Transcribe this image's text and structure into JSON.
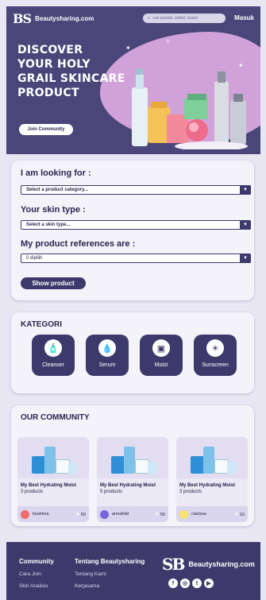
{
  "header": {
    "logo_mark": "BS",
    "brand": "Beautysharing.com",
    "search_placeholder": "cari produk, artikel, brand",
    "login": "Masuk"
  },
  "hero": {
    "line1": "DISCOVER",
    "line2": "YOUR HOLY",
    "line3": "GRAIL SKINCARE",
    "line4": "PRODUCT",
    "join_label": "Join Community"
  },
  "filter": {
    "looking_label": "I am looking for :",
    "category_value": "Select a product category...",
    "skin_label": "Your skin type :",
    "skin_value": "Select a skin type...",
    "ref_label": "My product references are :",
    "ref_value": "0 dipilih",
    "show_label": "Show product"
  },
  "kategori": {
    "title": "KATEGORI",
    "items": [
      {
        "label": "Cleanser",
        "icon": "cleanser-icon"
      },
      {
        "label": "Serum",
        "icon": "serum-icon"
      },
      {
        "label": "Moist",
        "icon": "moisturizer-icon"
      },
      {
        "label": "Sunscreen",
        "icon": "sunscreen-icon"
      }
    ]
  },
  "community": {
    "title": "OUR COMMUNITY",
    "posts": [
      {
        "title": "My Best Hydrating Moist",
        "count": "3 products",
        "user": "louimina",
        "likes": "50",
        "avatar_color": "#f06b6b"
      },
      {
        "title": "My Best Hydrating Moist",
        "count": "5 products",
        "user": "annafold",
        "likes": "50",
        "avatar_color": "#7a63e0"
      },
      {
        "title": "My Best Hydrating Moist",
        "count": "3 products",
        "user": "clarissa",
        "likes": "10",
        "avatar_color": "#f5e36a"
      }
    ]
  },
  "footer": {
    "col1_head": "Community",
    "col1_links": [
      "Cara Join",
      "Skin Analisis"
    ],
    "col2_head": "Tentang Beautysharing",
    "col2_links": [
      "Tentang Kami",
      "Kerjasama"
    ],
    "logo_mark": "SB",
    "brand": "Beautysharing.com",
    "socials": [
      {
        "label": "f",
        "icon": "facebook-icon"
      },
      {
        "label": "◎",
        "icon": "instagram-icon"
      },
      {
        "label": "t",
        "icon": "twitter-icon"
      },
      {
        "label": "▶",
        "icon": "youtube-icon"
      }
    ]
  },
  "colors": {
    "primary": "#3d3a6b",
    "hero_bg": "#4a4679",
    "accent": "#d8a8de",
    "page_bg": "#e9e6f3"
  }
}
